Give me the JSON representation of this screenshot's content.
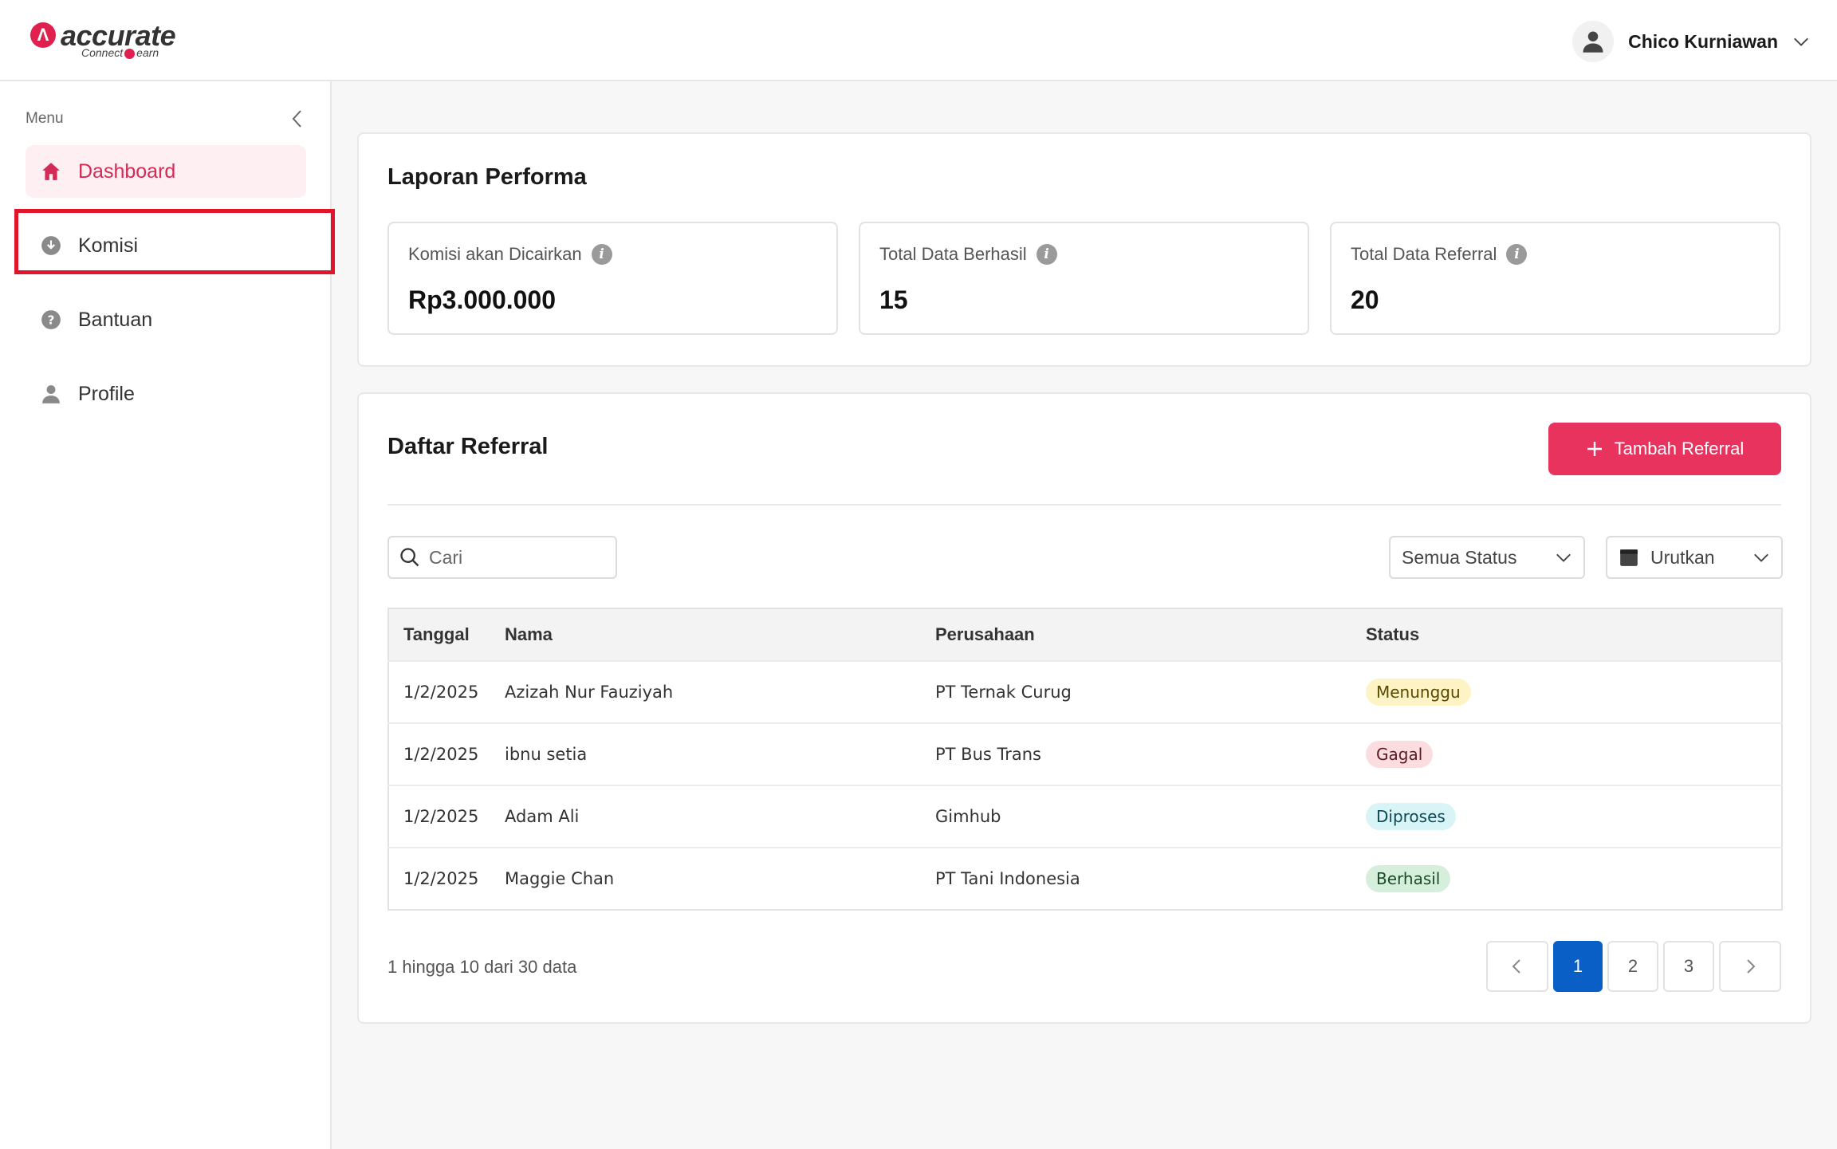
{
  "brand": {
    "name": "accurate",
    "sub_left": "Connect",
    "sub_right": "earn",
    "accent": "#e0204f"
  },
  "header": {
    "user_name": "Chico Kurniawan"
  },
  "sidebar": {
    "menu_label": "Menu",
    "items": [
      {
        "label": "Dashboard",
        "icon": "home-icon",
        "active": true
      },
      {
        "label": "Komisi",
        "icon": "download-circle-icon",
        "active": false
      },
      {
        "label": "Bantuan",
        "icon": "help-circle-icon",
        "active": false
      },
      {
        "label": "Profile",
        "icon": "user-icon",
        "active": false
      }
    ]
  },
  "performance": {
    "title": "Laporan Performa",
    "stats": [
      {
        "label": "Komisi akan Dicairkan",
        "value": "Rp3.000.000"
      },
      {
        "label": "Total Data Berhasil",
        "value": "15"
      },
      {
        "label": "Total Data Referral",
        "value": "20"
      }
    ]
  },
  "referrals": {
    "title": "Daftar Referral",
    "add_button": "Tambah Referral",
    "search_placeholder": "Cari",
    "status_filter": "Semua Status",
    "sort_label": "Urutkan",
    "columns": [
      "Tanggal",
      "Nama",
      "Perusahaan",
      "Status"
    ],
    "rows": [
      {
        "date": "1/2/2025",
        "name": "Azizah Nur Fauziyah",
        "company": "PT Ternak Curug",
        "status": "Menunggu",
        "bg": "#fdf3c4",
        "fg": "#5a4a00"
      },
      {
        "date": "1/2/2025",
        "name": "ibnu setia",
        "company": "PT Bus Trans",
        "status": "Gagal",
        "bg": "#fbdde0",
        "fg": "#5a1a20"
      },
      {
        "date": "1/2/2025",
        "name": "Adam Ali",
        "company": "Gimhub",
        "status": "Diproses",
        "bg": "#d8f4f7",
        "fg": "#0f4a55"
      },
      {
        "date": "1/2/2025",
        "name": "Maggie Chan",
        "company": "PT Tani Indonesia",
        "status": "Berhasil",
        "bg": "#d6efdc",
        "fg": "#1b4a28"
      }
    ],
    "summary": "1 hingga 10 dari 30 data",
    "pages": [
      "1",
      "2",
      "3"
    ],
    "current_page": "1"
  }
}
